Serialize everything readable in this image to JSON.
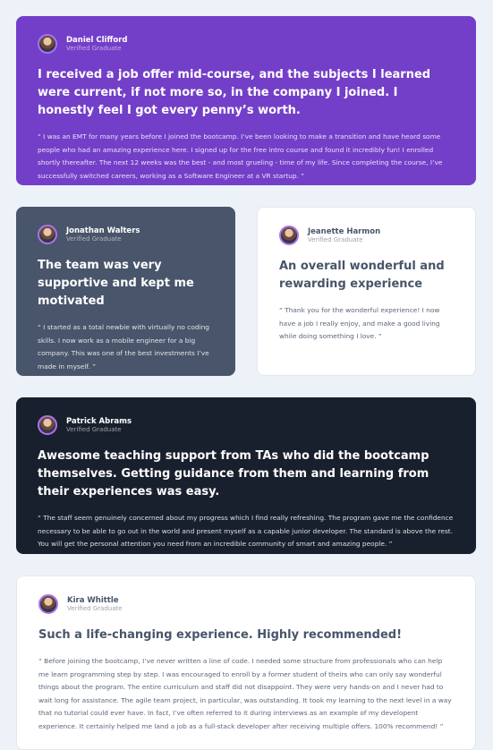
{
  "testimonials": [
    {
      "name": "Daniel Clifford",
      "role": "Verified Graduate",
      "title": "I received a job offer mid-course, and the subjects I learned were current, if not more so, in the company I joined. I honestly feel I got every penny’s worth.",
      "body": "“ I was an EMT for many years before I joined the bootcamp. I’ve been looking to make a transition and have heard some people who had an amazing experience here. I signed up for the free intro course and found it incredibly fun! I enrolled shortly thereafter. The next 12 weeks was the best - and most grueling - time of my life. Since completing the course, I’ve successfully switched careers, working as a Software Engineer at a VR startup. ”"
    },
    {
      "name": "Jonathan Walters",
      "role": "Verified Graduate",
      "title": "The team was very supportive and kept me motivated",
      "body": "“ I started as a total newbie with virtually no coding skills. I now work as a mobile engineer for a big company. This was one of the best investments I’ve made in myself. ”"
    },
    {
      "name": "Jeanette Harmon",
      "role": "Verified Graduate",
      "title": "An overall wonderful and rewarding experience",
      "body": "“ Thank you for the wonderful experience! I now have a job I really enjoy, and make a good living while doing something I love. ”"
    },
    {
      "name": "Patrick Abrams",
      "role": "Verified Graduate",
      "title": "Awesome teaching support from TAs who did the bootcamp themselves. Getting guidance from them and learning from their experiences was easy.",
      "body": "“ The staff seem genuinely concerned about my progress which I find really refreshing. The program gave me the confidence necessary to be able to go out in the world and present myself as a capable junior developer. The standard is above the rest. You will get the personal attention you need from an incredible community of smart and amazing people. ”"
    },
    {
      "name": "Kira Whittle",
      "role": "Verified Graduate",
      "title": "Such a life-changing experience. Highly recommended!",
      "body": "“ Before joining the bootcamp, I’ve never written a line of code. I needed some structure from professionals who can help me learn programming step by step. I was encouraged to enroll by a former student of theirs who can only say wonderful things about the program. The entire curriculum and staff did not disappoint. They were very hands-on and I never had to wait long for assistance. The agile team project, in particular, was outstanding. It took my learning to the next level in a way that no tutorial could ever have. In fact, I’ve often referred to it during interviews as an example of my developent experience. It certainly helped me land a job as a full-stack developer after receiving multiple offers. 100% recommend! ”"
    }
  ],
  "colors": {
    "purple": "#733fc8",
    "slate": "#48556a",
    "white": "#ffffff",
    "dark": "#19202d",
    "background": "#ecf2f8"
  }
}
